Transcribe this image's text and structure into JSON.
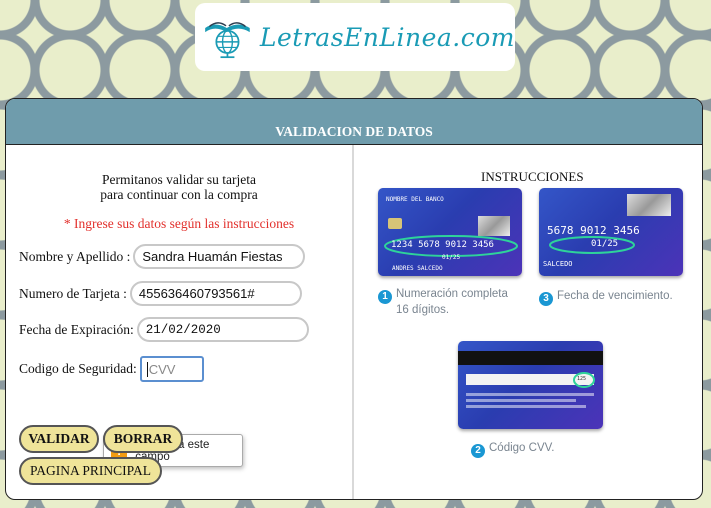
{
  "logo": {
    "text": "LetrasEnLinea.com"
  },
  "panel": {
    "title": "VALIDACION DE DATOS"
  },
  "form": {
    "intro_line1": "Permitanos validar su tarjeta",
    "intro_line2": "para continuar con la compra",
    "required_note": "* Ingrese sus datos según las instrucciones",
    "name_label": "Nombre y Apellido :",
    "name_value": "Sandra Huamán Fiestas",
    "card_label": "Numero de Tarjeta :",
    "card_value": "455636460793561#",
    "expiry_label": "Fecha de Expiración:",
    "expiry_value": "21/02/2020",
    "cvv_label": "Codigo de Seguridad:",
    "cvv_placeholder": "CVV",
    "tooltip": "Completa este campo"
  },
  "buttons": {
    "validate": "VALIDAR",
    "clear": "BORRAR",
    "home": "PAGINA PRINCIPAL"
  },
  "instructions": {
    "title": "INSTRUCCIONES",
    "step1_num": "1",
    "step1_line1": "Numeración completa",
    "step1_line2": "16 dígitos.",
    "step3_num": "3",
    "step3": "Fecha de vencimiento.",
    "step2_num": "2",
    "step2": "Código CVV.",
    "card1": {
      "bank": "NOMBRE DEL BANCO",
      "number": "1234 5678 9012 3456",
      "expiry": "01/25",
      "holder": "ANDRES SALCEDO"
    },
    "card3": {
      "number": "5678 9012 3456",
      "expiry": "01/25",
      "holder": "SALCEDO"
    },
    "card2": {
      "cvv": "125"
    }
  },
  "colors": {
    "header": "#6f9cac",
    "button": "#efe499",
    "required": "#e2302c",
    "accent": "#1a97d3"
  }
}
